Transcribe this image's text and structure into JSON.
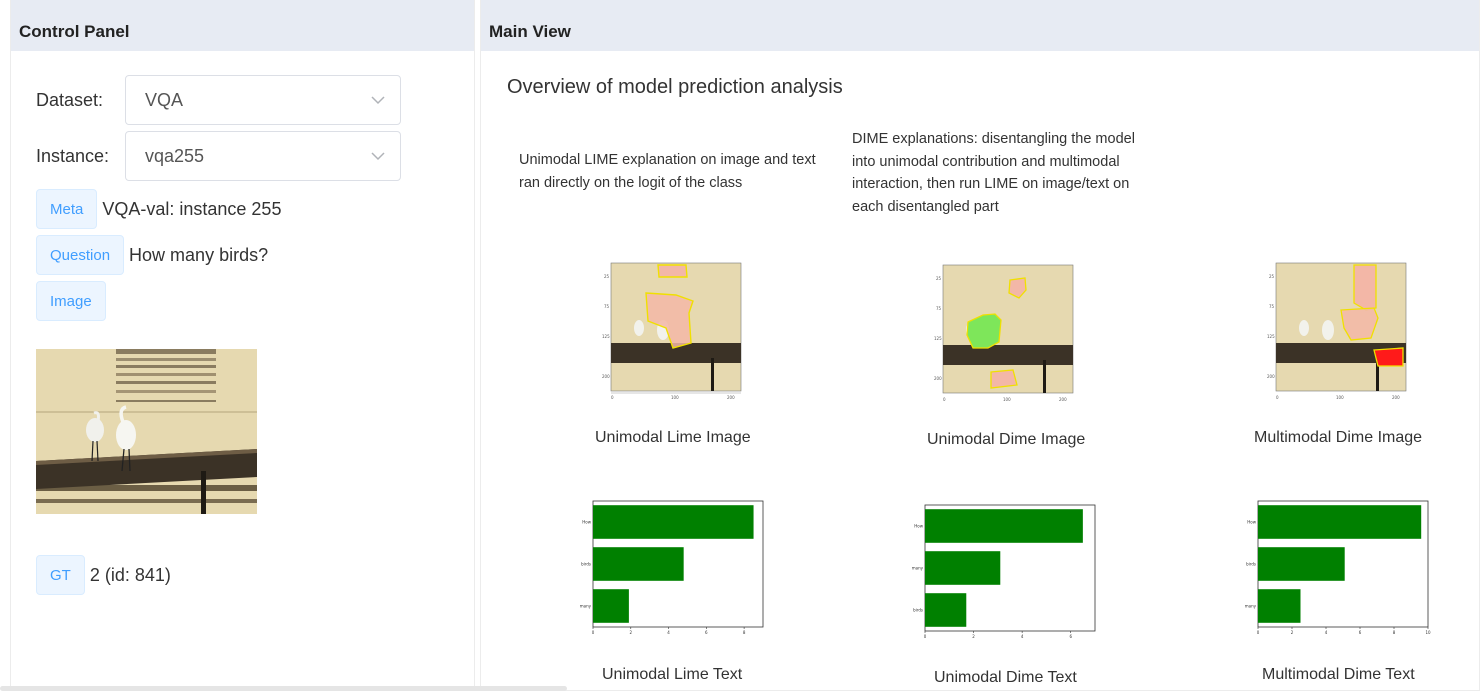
{
  "control_panel": {
    "title": "Control Panel",
    "dataset": {
      "label": "Dataset:",
      "value": "VQA"
    },
    "instance": {
      "label": "Instance:",
      "value": "vqa255"
    },
    "meta": {
      "tag": "Meta",
      "text": "VQA-val: instance 255"
    },
    "question": {
      "tag": "Question",
      "text": "How many birds?"
    },
    "image": {
      "tag": "Image"
    },
    "gt": {
      "tag": "GT",
      "text": "2 (id: 841)"
    }
  },
  "main_view": {
    "title": "Main View",
    "heading": "Overview of model prediction analysis",
    "desc_lime": "Unimodal LIME explanation on image and text ran directly on the logit of the class",
    "desc_dime": "DIME explanations: disentangling the model into unimodal contribution and multimodal interaction, then run LIME on image/text on each disentangled part",
    "captions": {
      "unimodal_lime_image": "Unimodal Lime Image",
      "unimodal_dime_image": "Unimodal Dime Image",
      "multimodal_dime_image": "Multimodal Dime Image",
      "unimodal_lime_text": "Unimodal Lime Text",
      "unimodal_dime_text": "Unimodal Dime Text",
      "multimodal_dime_text": "Multimodal Dime Text"
    }
  },
  "colors": {
    "bar": "#008000",
    "tag_bg": "#ecf5ff",
    "tag_fg": "#409eff",
    "header_bg": "#e7ebf3"
  },
  "chart_data": [
    {
      "type": "bar",
      "orientation": "horizontal",
      "title": "Unimodal Lime Text",
      "categories": [
        "How",
        "birds",
        "many"
      ],
      "values": [
        8.5,
        4.8,
        1.9
      ],
      "xlim": [
        0,
        9
      ]
    },
    {
      "type": "bar",
      "orientation": "horizontal",
      "title": "Unimodal Dime Text",
      "categories": [
        "How",
        "many",
        "birds"
      ],
      "values": [
        6.5,
        3.1,
        1.7
      ],
      "xlim": [
        0,
        7
      ]
    },
    {
      "type": "bar",
      "orientation": "horizontal",
      "title": "Multimodal Dime Text",
      "categories": [
        "How",
        "birds",
        "many"
      ],
      "values": [
        9.6,
        5.1,
        2.5
      ],
      "xlim": [
        0,
        10
      ]
    }
  ]
}
